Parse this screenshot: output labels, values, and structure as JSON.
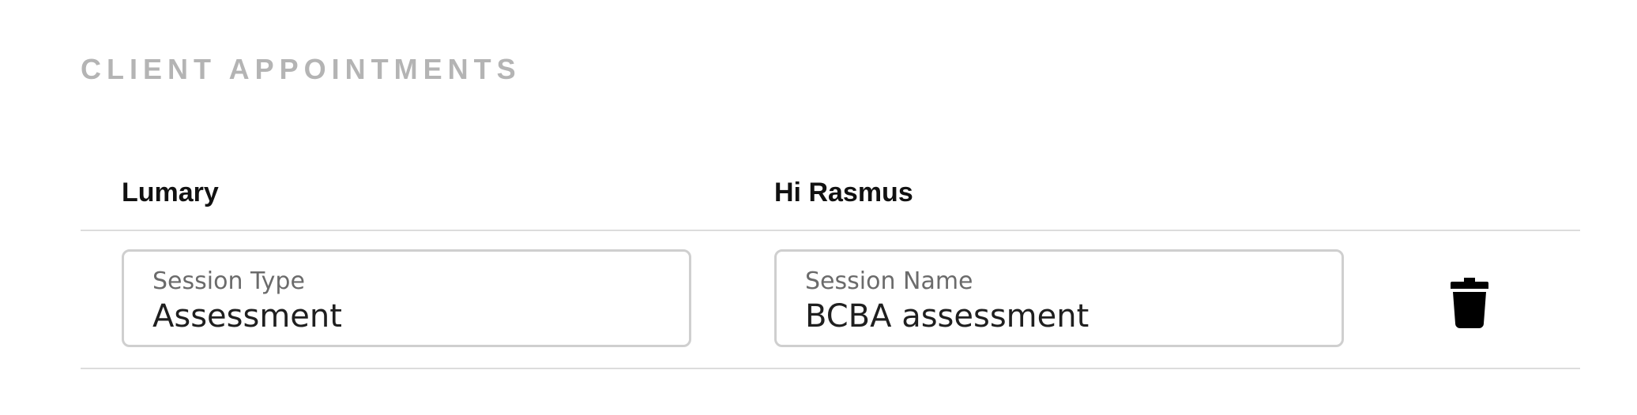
{
  "section": {
    "title": "CLIENT APPOINTMENTS"
  },
  "table": {
    "headers": [
      "Lumary",
      "Hi Rasmus"
    ],
    "rows": [
      {
        "session_type": {
          "label": "Session Type",
          "value": "Assessment"
        },
        "session_name": {
          "label": "Session Name",
          "value": "BCBA assessment"
        },
        "delete_icon": "trash-icon"
      }
    ]
  },
  "colors": {
    "section_title": "#b4b4b4",
    "divider": "#dcdcdc",
    "field_border": "#cfcfcf",
    "icon": "#000000"
  }
}
